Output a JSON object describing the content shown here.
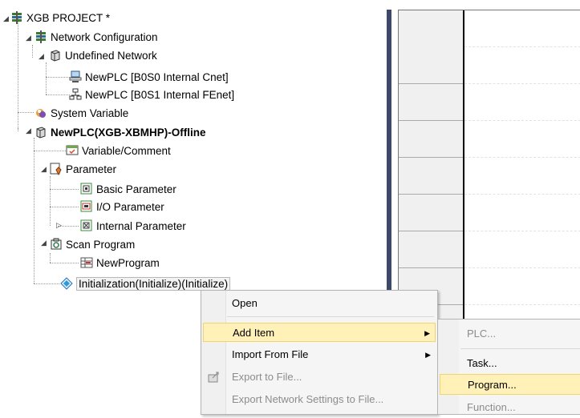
{
  "tree": {
    "project": "XGB PROJECT *",
    "network_configuration": "Network Configuration",
    "undefined_network": "Undefined Network",
    "newplc_cnet": "NewPLC [B0S0 Internal Cnet]",
    "newplc_fenet": "NewPLC [B0S1 Internal FEnet]",
    "system_variable": "System Variable",
    "plc": "NewPLC(XGB-XBMHP)-Offline",
    "variable_comment": "Variable/Comment",
    "parameter": "Parameter",
    "basic_parameter": "Basic Parameter",
    "io_parameter": "I/O Parameter",
    "internal_parameter": "Internal Parameter",
    "scan_program": "Scan Program",
    "new_program": "NewProgram",
    "initialization": "Initialization(Initialize)(Initialize)"
  },
  "context_menu": {
    "open": "Open",
    "add_item": "Add Item",
    "import_from_file": "Import From File",
    "export_to_file": "Export to File...",
    "export_network_settings": "Export Network Settings to File..."
  },
  "submenu": {
    "plc": "PLC...",
    "task": "Task...",
    "program": "Program...",
    "function": "Function..."
  },
  "colors": {
    "highlight": "#fff1b8",
    "splitter": "#3c4a66",
    "disabled_text": "#8c8c8c"
  }
}
